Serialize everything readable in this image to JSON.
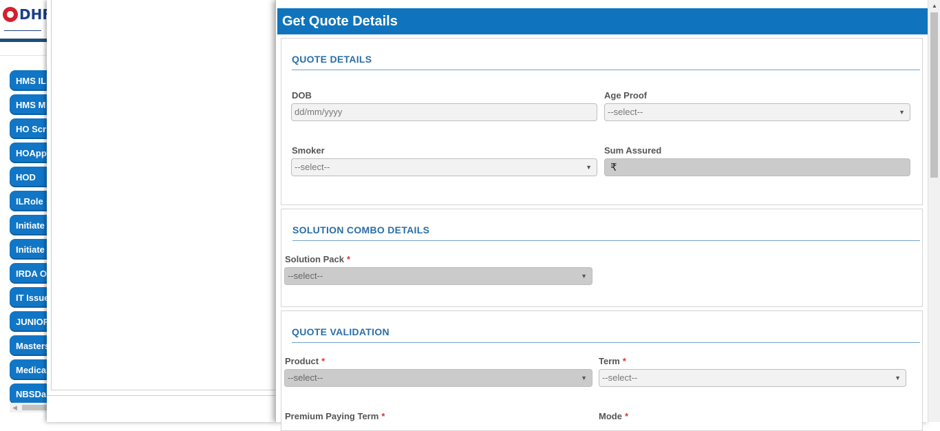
{
  "brand": {
    "logo_text": "DHF"
  },
  "sidebar": {
    "items": [
      {
        "label": "HMS IL"
      },
      {
        "label": "HMS M"
      },
      {
        "label": "HO Scr"
      },
      {
        "label": "HOApp"
      },
      {
        "label": "HOD"
      },
      {
        "label": "ILRole"
      },
      {
        "label": "Initiate"
      },
      {
        "label": "Initiate"
      },
      {
        "label": "IRDA O"
      },
      {
        "label": "IT Issue"
      },
      {
        "label": "JUNIOR"
      },
      {
        "label": "Masters"
      },
      {
        "label": "Medical"
      },
      {
        "label": "NBSDa"
      }
    ]
  },
  "dialog": {
    "title": "Get Quote Details",
    "quote_details": {
      "heading": "QUOTE DETAILS",
      "dob": {
        "label": "DOB",
        "placeholder": "dd/mm/yyyy"
      },
      "age_proof": {
        "label": "Age Proof",
        "value": "--select--"
      },
      "smoker": {
        "label": "Smoker",
        "value": "--select--"
      },
      "sum_assured": {
        "label": "Sum Assured",
        "prefix": "₹"
      }
    },
    "solution_combo": {
      "heading": "SOLUTION COMBO DETAILS",
      "solution_pack": {
        "label": "Solution Pack",
        "required": "*",
        "value": "--select--"
      }
    },
    "quote_validation": {
      "heading": "QUOTE VALIDATION",
      "product": {
        "label": "Product",
        "required": "*",
        "value": "--select--"
      },
      "term": {
        "label": "Term",
        "required": "*",
        "value": "--select--"
      },
      "premium_paying_term": {
        "label": "Premium Paying Term",
        "required": "*"
      },
      "mode": {
        "label": "Mode",
        "required": "*"
      }
    }
  },
  "colors": {
    "header_blue": "#0f74bd",
    "section_heading": "#2b6ea6",
    "sidebar_button": "#1176c6",
    "required": "#dd3333"
  }
}
